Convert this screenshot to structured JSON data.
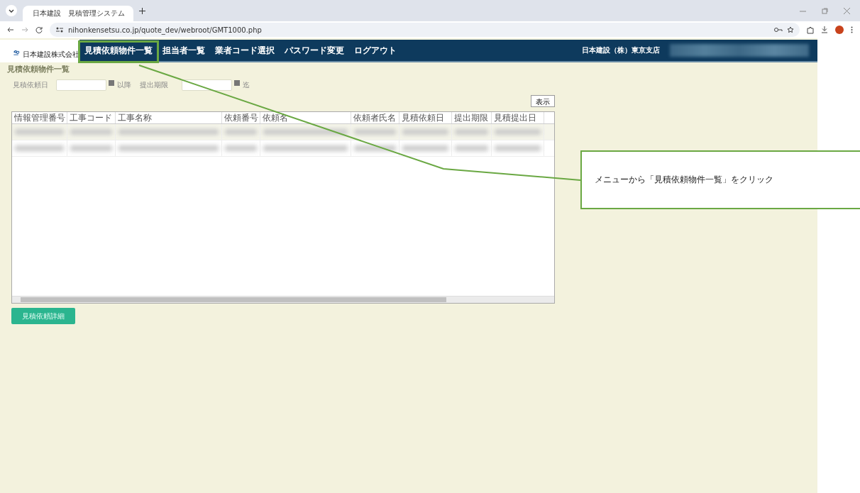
{
  "browser": {
    "tab_title": "日本建設　見積管理システム",
    "url": "nihonkensetsu.co.jp/quote_dev/webroot/GMT1000.php"
  },
  "logo": {
    "company": "日本建設株式会社"
  },
  "nav": {
    "items": [
      "見積依頼物件一覧",
      "担当者一覧",
      "業者コード選択",
      "パスワード変更",
      "ログアウト"
    ],
    "user_branch": "日本建設（株）東京支店"
  },
  "page_title": "見積依頼物件一覧",
  "filters": {
    "request_date_label": "見積依頼日",
    "after_label": "以降",
    "deadline_label": "提出期限",
    "until_label": "迄"
  },
  "show_button": "表示",
  "table": {
    "columns": [
      "情報管理番号",
      "工事コード",
      "工事名称",
      "依頼番号",
      "依頼名",
      "依頼者氏名",
      "見積依頼日",
      "提出期限",
      "見積提出日"
    ]
  },
  "detail_button": "見積依頼詳細",
  "callout": {
    "text": "メニューから「見積依頼物件一覧」をクリック"
  }
}
